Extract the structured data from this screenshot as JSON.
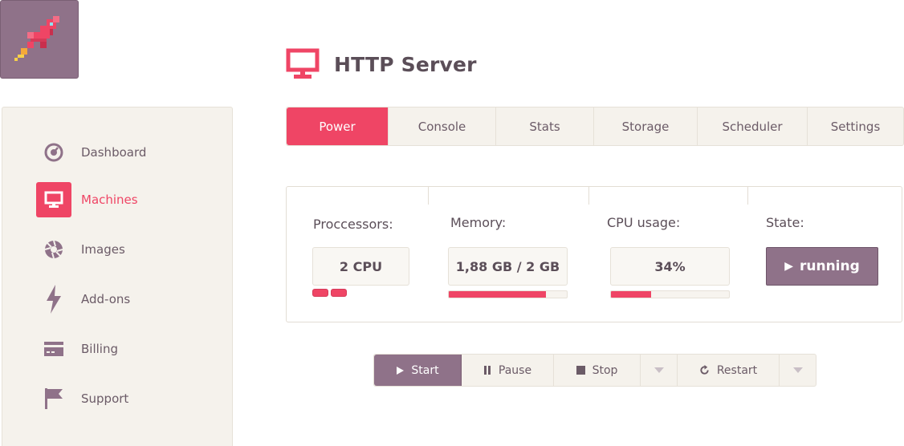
{
  "app": {
    "logo_icon": "rocket-icon"
  },
  "sidebar": {
    "items": [
      {
        "label": "Dashboard",
        "icon": "dashboard-icon",
        "active": false
      },
      {
        "label": "Machines",
        "icon": "monitor-icon",
        "active": true
      },
      {
        "label": "Images",
        "icon": "aperture-icon",
        "active": false
      },
      {
        "label": "Add-ons",
        "icon": "lightning-icon",
        "active": false
      },
      {
        "label": "Billing",
        "icon": "credit-card-icon",
        "active": false
      },
      {
        "label": "Support",
        "icon": "flag-icon",
        "active": false
      }
    ]
  },
  "header": {
    "title": "HTTP Server",
    "icon": "monitor-icon"
  },
  "tabs": [
    {
      "label": "Power",
      "active": true
    },
    {
      "label": "Console",
      "active": false
    },
    {
      "label": "Stats",
      "active": false
    },
    {
      "label": "Storage",
      "active": false
    },
    {
      "label": "Scheduler",
      "active": false
    },
    {
      "label": "Settings",
      "active": false
    }
  ],
  "stats": {
    "processors": {
      "label": "Proccessors:",
      "value": "2 CPU",
      "chips": 2
    },
    "memory": {
      "label": "Memory:",
      "value": "1,88 GB / 2 GB",
      "fraction": 0.82
    },
    "cpu": {
      "label": "CPU usage:",
      "value": "34%",
      "fraction": 0.34
    },
    "state": {
      "label": "State:",
      "value": "running"
    }
  },
  "actions": {
    "start": "Start",
    "pause": "Pause",
    "stop": "Stop",
    "restart": "Restart"
  },
  "colors": {
    "accent": "#ef4565",
    "primary": "#8f7289",
    "panel_bg": "#f5f2ec"
  }
}
